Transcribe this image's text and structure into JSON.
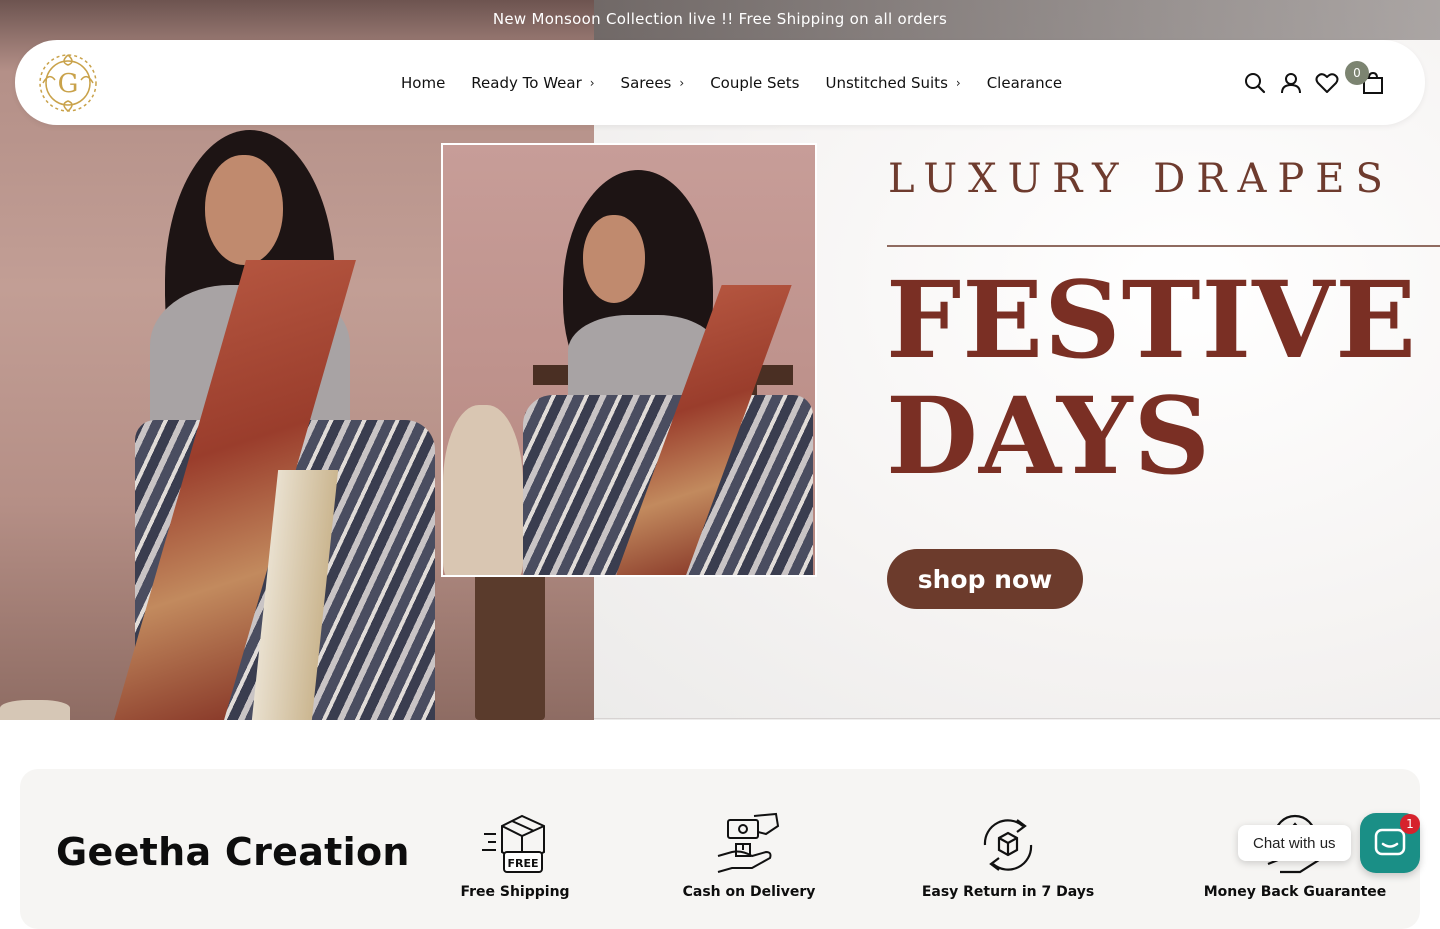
{
  "announcement": {
    "text": "New Monsoon Collection live !! Free Shipping on all orders"
  },
  "header": {
    "logo_letter": "G",
    "nav": [
      {
        "label": "Home",
        "has_submenu": false
      },
      {
        "label": "Ready To Wear",
        "has_submenu": true
      },
      {
        "label": "Sarees",
        "has_submenu": true
      },
      {
        "label": "Couple Sets",
        "has_submenu": false
      },
      {
        "label": "Unstitched Suits",
        "has_submenu": true
      },
      {
        "label": "Clearance",
        "has_submenu": false
      }
    ],
    "icons": [
      "search-icon",
      "account-icon",
      "wishlist-heart-icon",
      "cart-bag-icon"
    ],
    "cart_count": "0"
  },
  "hero": {
    "tagline": "LUXURY DRAPES",
    "headline_line1": "FESTIVE",
    "headline_line2": "DAYS",
    "cta_label": "shop now"
  },
  "features": {
    "brand_title": "Geetha Creation",
    "items": [
      {
        "label": "Free Shipping",
        "icon": "free-shipping-box-icon",
        "icon_text": "FREE"
      },
      {
        "label": "Cash on Delivery",
        "icon": "cash-on-delivery-icon"
      },
      {
        "label": "Easy Return in 7 Days",
        "icon": "easy-return-icon"
      },
      {
        "label": "Money Back Guarantee",
        "icon": "money-back-icon"
      }
    ]
  },
  "chat": {
    "label": "Chat with us",
    "unread": "1"
  },
  "colors": {
    "headline": "#7a2f24",
    "cta_bg": "#6c3b2c",
    "cart_badge": "#7c8471",
    "chat_button": "#1a8f86",
    "chat_badge": "#d6222c"
  }
}
